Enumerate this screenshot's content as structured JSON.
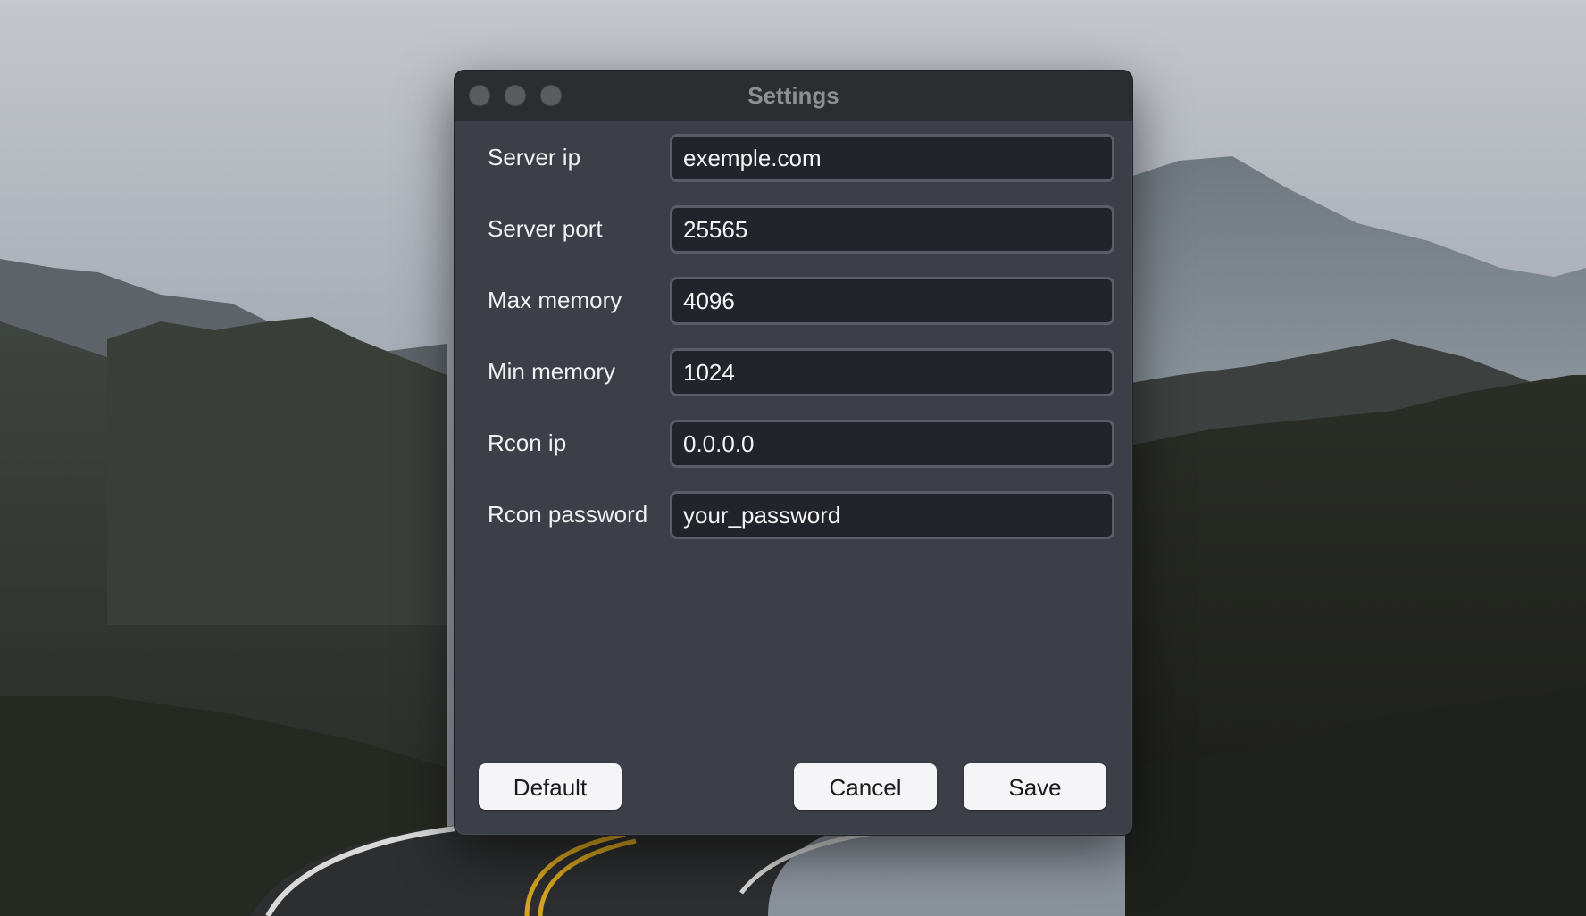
{
  "window": {
    "title": "Settings"
  },
  "form": {
    "fields": [
      {
        "label": "Server ip",
        "value": "exemple.com"
      },
      {
        "label": "Server port",
        "value": "25565"
      },
      {
        "label": "Max memory",
        "value": "4096"
      },
      {
        "label": "Min memory",
        "value": "1024"
      },
      {
        "label": "Rcon ip",
        "value": "0.0.0.0"
      },
      {
        "label": "Rcon password",
        "value": "your_password"
      }
    ]
  },
  "buttons": {
    "default_label": "Default",
    "cancel_label": "Cancel",
    "save_label": "Save"
  },
  "colors": {
    "window_bg": "#3c3f47",
    "titlebar_bg": "#2c2d31",
    "input_bg": "#22242b",
    "button_bg": "#f5f5f7"
  }
}
